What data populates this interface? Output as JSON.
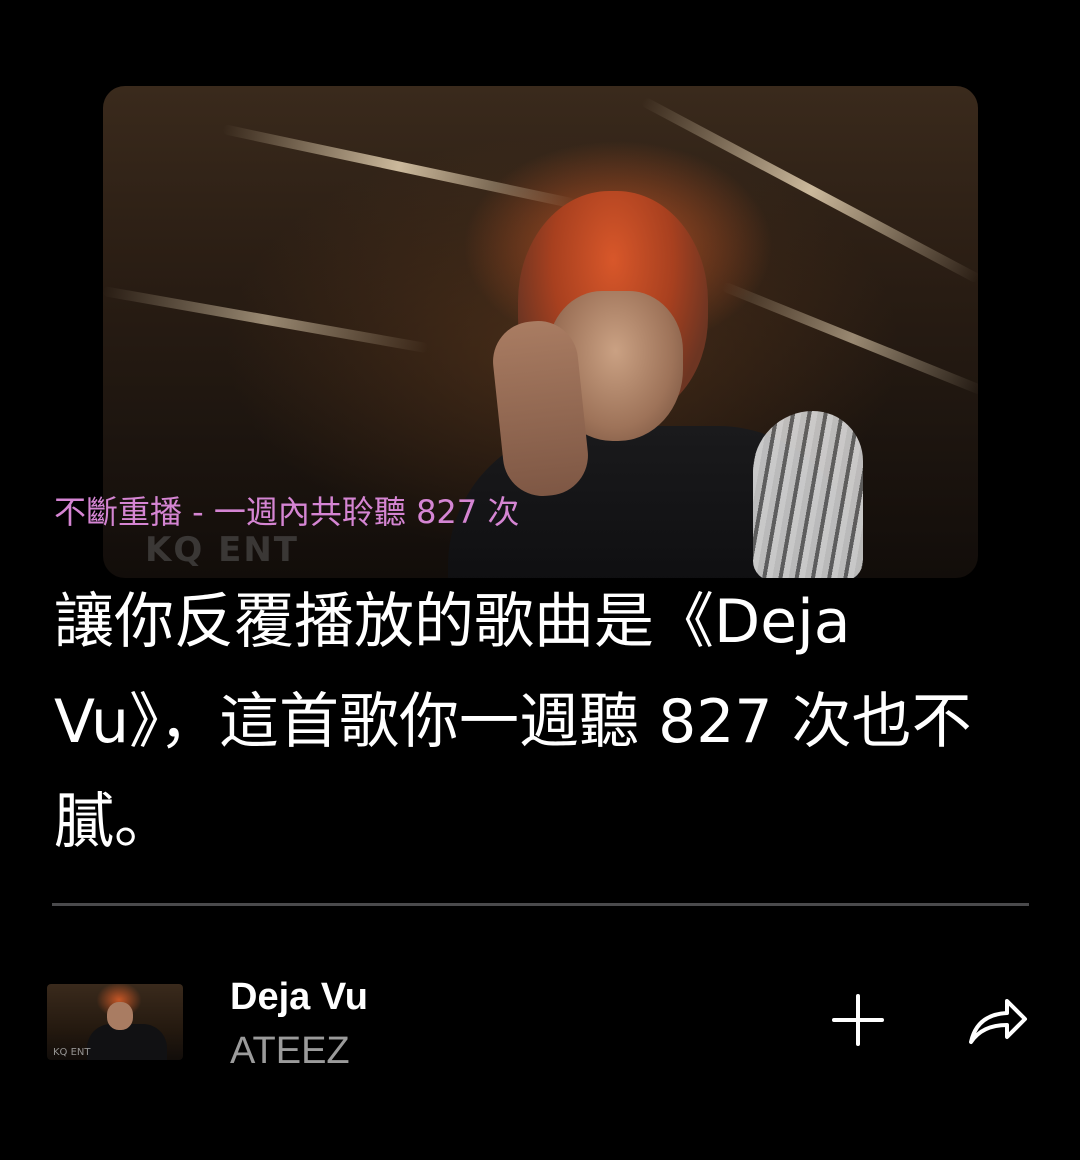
{
  "hero": {
    "image_label": "ATEEZ Deja Vu artwork",
    "watermark": "KQ ENT"
  },
  "recap": {
    "subtitle": "不斷重播 - 一週內共聆聽 827 次",
    "headline": "讓你反覆播放的歌曲是《Deja Vu》，這首歌你一週聽 827 次也不膩。"
  },
  "track": {
    "title": "Deja Vu",
    "artist": "ATEEZ",
    "thumb_watermark": "KQ ENT"
  },
  "actions": {
    "add_icon": "plus-icon",
    "share_icon": "share-arrow-icon"
  },
  "colors": {
    "background": "#000000",
    "subtitle": "#d585d3",
    "headline": "#ffffff",
    "artist": "#9b9b9b",
    "divider": "#4a4a4c"
  }
}
